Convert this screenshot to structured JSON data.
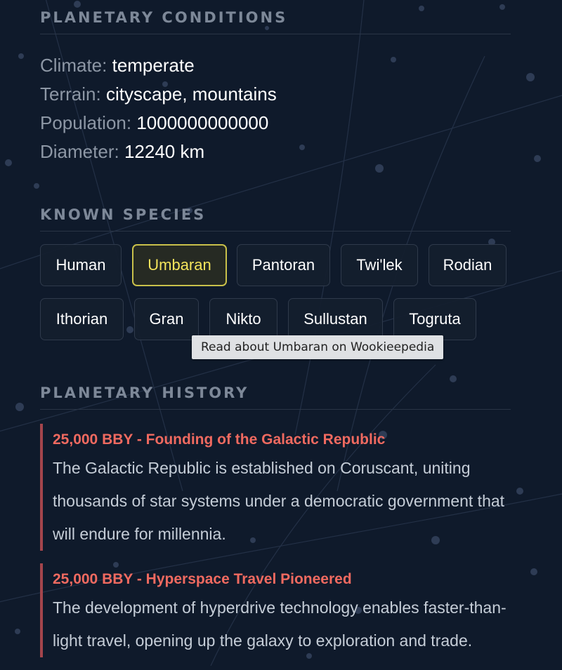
{
  "sections": {
    "conditions": {
      "title": "PLANETARY CONDITIONS",
      "rows": [
        {
          "label": "Climate:",
          "value": "temperate"
        },
        {
          "label": "Terrain:",
          "value": "cityscape, mountains"
        },
        {
          "label": "Population:",
          "value": "1000000000000"
        },
        {
          "label": "Diameter:",
          "value": "12240 km"
        }
      ]
    },
    "species": {
      "title": "KNOWN SPECIES",
      "items": [
        "Human",
        "Umbaran",
        "Pantoran",
        "Twi'lek",
        "Rodian",
        "Ithorian",
        "Gran",
        "Nikto",
        "Sullustan",
        "Togruta"
      ],
      "active": "Umbaran",
      "tooltip": "Read about Umbaran on Wookieepedia"
    },
    "history": {
      "title": "PLANETARY HISTORY",
      "events": [
        {
          "title": "25,000 BBY - Founding of the Galactic Republic",
          "text": "The Galactic Republic is established on Coruscant, uniting thousands of star systems under a democratic government that will endure for millennia."
        },
        {
          "title": "25,000 BBY - Hyperspace Travel Pioneered",
          "text": "The development of hyperdrive technology enables faster-than-light travel, opening up the galaxy to exploration and trade."
        }
      ]
    }
  },
  "colors": {
    "background": "#0f1a2b",
    "heading": "#7d8898",
    "label": "#8d97a5",
    "value": "#ffffff",
    "accent_species": "#c9c04a",
    "accent_history": "#f06a60",
    "timeline_bar": "#a4454c"
  }
}
